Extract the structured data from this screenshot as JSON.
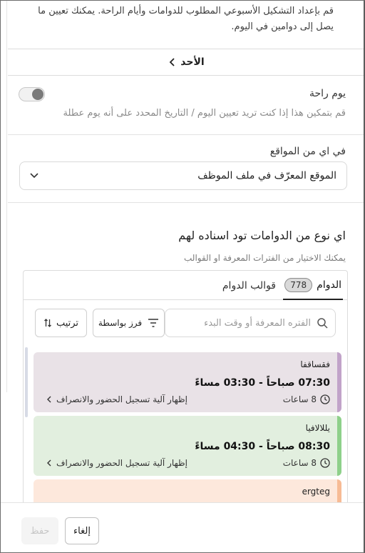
{
  "intro": {
    "text": "قم بإعداد التشكيل الأسبوعي المطلوب للدوامات وأيام الراحة. يمكنك تعيين ما يصل إلى دوامين في اليوم."
  },
  "day_nav": {
    "label": "الأحد",
    "chevron_icon": "chevron-left-icon"
  },
  "rest_day": {
    "title": "يوم راحة",
    "description": "قم بتمكين هذا إذا كنت تريد تعيين اليوم / التاريخ المحدد على أنه يوم عطلة",
    "enabled": false
  },
  "location": {
    "title": "في اي من المواقع",
    "selected": "الموقع المعرّف في ملف الموظف"
  },
  "shift_section": {
    "title": "اي نوع من الدوامات تود اسناده لهم",
    "subtitle": "يمكنك الاختيار من الفترات المعرفة او القوالب"
  },
  "tabs": {
    "shifts_label": "الدوام",
    "shifts_count": "778",
    "templates_label": "قوالب الدوام"
  },
  "search": {
    "placeholder": "الفتره المعرفة أو وقت البدء"
  },
  "toolbar": {
    "sort_by_label": "فرز بواسطة",
    "order_label": "ترتيب"
  },
  "shifts": [
    {
      "name": "فقساقفا",
      "time": "07:30 صباحاً - 03:30 مساءً",
      "duration": "8 ساعات",
      "attendance_label": "إظهار آلية تسجيل الحضور والانصراف",
      "color": "#c1a3c9",
      "bg": "#e9e2e7"
    },
    {
      "name": "يللالافيا",
      "time": "08:30 صباحاً - 04:30 مساءً",
      "duration": "8 ساعات",
      "attendance_label": "إظهار آلية تسجيل الحضور والانصراف",
      "color": "#8ed08a",
      "bg": "#e2efdf"
    },
    {
      "name": "ergteg",
      "color": "#f7bb95",
      "bg": "#fde8dc"
    }
  ],
  "footer": {
    "cancel_label": "إلغاء",
    "save_label": "حفظ"
  }
}
